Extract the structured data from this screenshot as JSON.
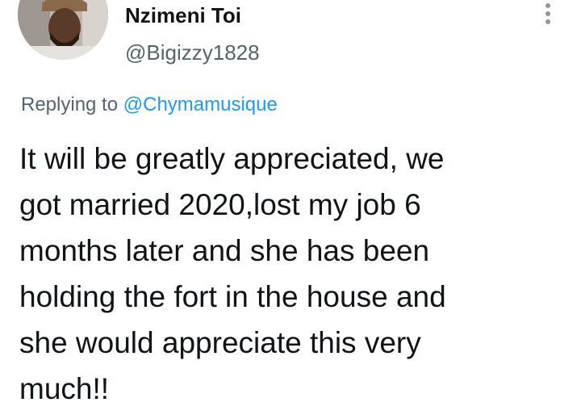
{
  "user": {
    "display_name": "Nzimeni Toi",
    "handle": "@Bigizzy1828"
  },
  "reply": {
    "prefix": "Replying to",
    "mention": "@Chymamusique"
  },
  "tweet": {
    "lines": [
      "It will be greatly appreciated, we",
      "got married 2020,lost my job 6",
      "months later and she has been",
      "holding the fort in the house and",
      "she would appreciate this very",
      "much!!"
    ]
  },
  "colors": {
    "text_primary": "#0f1419",
    "text_secondary": "#536471",
    "link": "#1d9bf0"
  },
  "icons": {
    "menu": "more-vertical-icon"
  }
}
